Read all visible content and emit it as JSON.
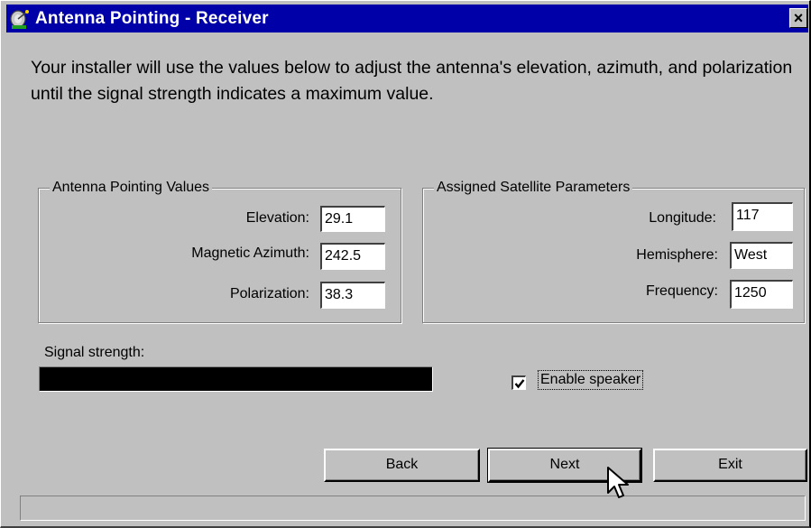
{
  "window": {
    "title": "Antenna Pointing - Receiver",
    "close_glyph": "×",
    "app_icon": "satellite-dish-icon"
  },
  "intro": {
    "text": "Your installer will use the values below to adjust the antenna's elevation, azimuth, and polarization until the signal strength indicates a maximum value."
  },
  "pointing": {
    "title": "Antenna Pointing Values",
    "elevation_label": "Elevation:",
    "elevation_value": "29.1",
    "azimuth_label": "Magnetic Azimuth:",
    "azimuth_value": "242.5",
    "polarization_label": "Polarization:",
    "polarization_value": "38.3"
  },
  "satellite": {
    "title": "Assigned Satellite Parameters",
    "longitude_label": "Longitude:",
    "longitude_value": "117",
    "hemisphere_label": "Hemisphere:",
    "hemisphere_value": "West",
    "frequency_label": "Frequency:",
    "frequency_value": "1250"
  },
  "signal": {
    "label": "Signal strength:",
    "level": 1.0
  },
  "speaker": {
    "label": "Enable speaker",
    "checked": true
  },
  "buttons": {
    "back": "Back",
    "next": "Next",
    "exit": "Exit"
  },
  "colors": {
    "titlebar": "#0000a8",
    "face": "#c0c0c0"
  }
}
